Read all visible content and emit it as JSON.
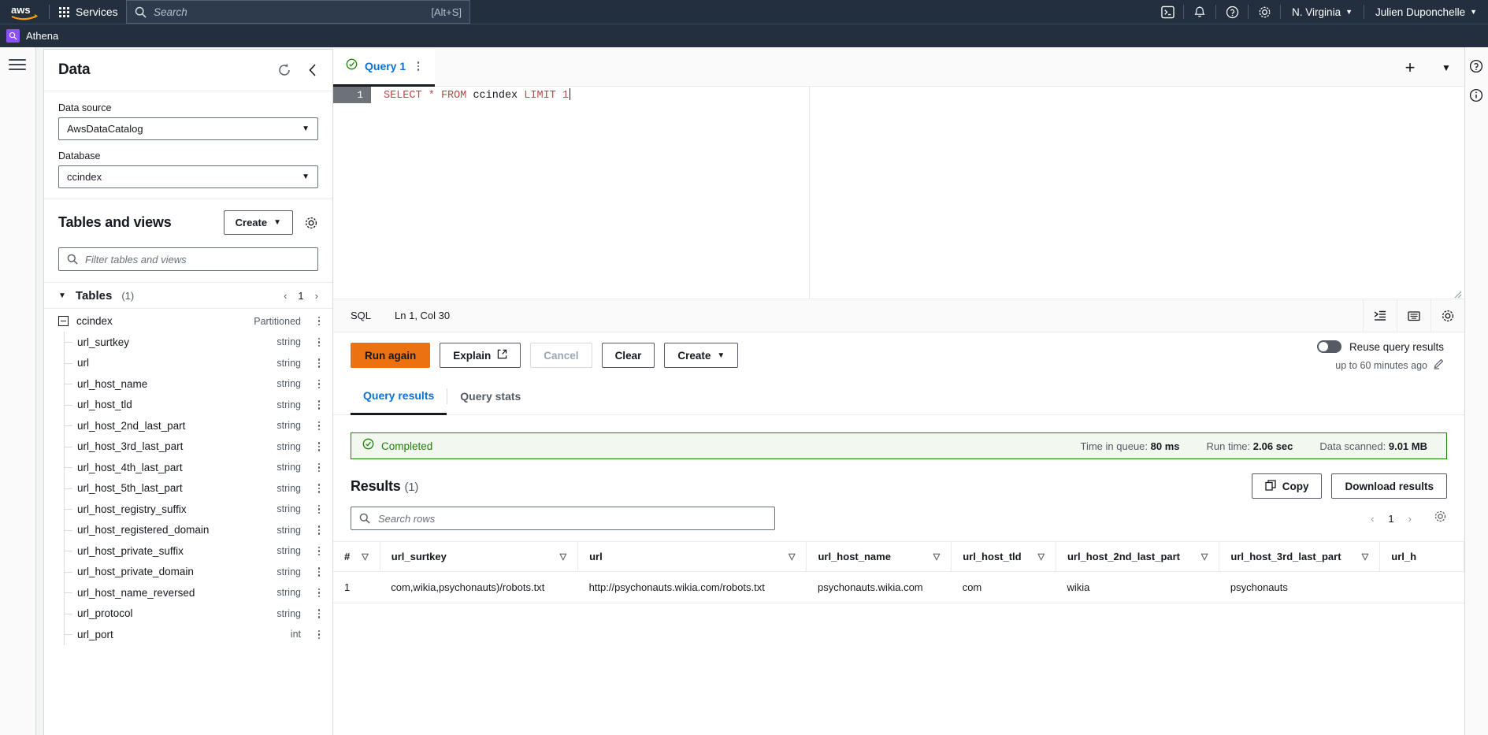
{
  "topnav": {
    "logo_alt": "aws",
    "services_label": "Services",
    "search_placeholder": "Search",
    "search_shortcut": "[Alt+S]",
    "region_label": "N. Virginia",
    "account_label": "Julien Duponchelle",
    "icons": [
      "cloudshell-icon",
      "notifications-bell-icon",
      "help-question-icon",
      "settings-gear-icon"
    ]
  },
  "servicebar": {
    "service_name": "Athena"
  },
  "data_panel": {
    "title": "Data",
    "refresh_icon": "refresh-icon",
    "collapse_icon": "chevron-left-icon",
    "data_source_label": "Data source",
    "data_source_value": "AwsDataCatalog",
    "database_label": "Database",
    "database_value": "ccindex",
    "tables_views_title": "Tables and views",
    "create_label": "Create",
    "settings_icon": "gear-icon",
    "filter_placeholder": "Filter tables and views",
    "tables_header": "Tables",
    "tables_count": "(1)",
    "page_number": "1",
    "table_name": "ccindex",
    "table_meta": "Partitioned",
    "columns": [
      {
        "name": "url_surtkey",
        "type": "string"
      },
      {
        "name": "url",
        "type": "string"
      },
      {
        "name": "url_host_name",
        "type": "string"
      },
      {
        "name": "url_host_tld",
        "type": "string"
      },
      {
        "name": "url_host_2nd_last_part",
        "type": "string"
      },
      {
        "name": "url_host_3rd_last_part",
        "type": "string"
      },
      {
        "name": "url_host_4th_last_part",
        "type": "string"
      },
      {
        "name": "url_host_5th_last_part",
        "type": "string"
      },
      {
        "name": "url_host_registry_suffix",
        "type": "string"
      },
      {
        "name": "url_host_registered_domain",
        "type": "string"
      },
      {
        "name": "url_host_private_suffix",
        "type": "string"
      },
      {
        "name": "url_host_private_domain",
        "type": "string"
      },
      {
        "name": "url_host_name_reversed",
        "type": "string"
      },
      {
        "name": "url_protocol",
        "type": "string"
      },
      {
        "name": "url_port",
        "type": "int"
      }
    ]
  },
  "editor": {
    "tab_label": "Query 1",
    "tab_status_icon": "check-circle-icon",
    "tab_menu_icon": "kebab-menu-icon",
    "add_tab_icon": "plus-icon",
    "tab_dropdown_icon": "chevron-down-icon",
    "line_number": "1",
    "sql_keyword_1": "SELECT",
    "sql_star": "*",
    "sql_keyword_2": "FROM",
    "sql_table": "ccindex",
    "sql_keyword_3": "LIMIT",
    "sql_number": "1",
    "sql_full": "SELECT * FROM ccindex LIMIT 1",
    "status_language": "SQL",
    "status_position": "Ln 1, Col 30",
    "format_icon": "format-indent-icon",
    "shortcuts_icon": "keyboard-icon",
    "editor_settings_icon": "gear-icon"
  },
  "actions": {
    "run_again": "Run again",
    "explain": "Explain",
    "explain_icon": "external-link-icon",
    "cancel": "Cancel",
    "clear": "Clear",
    "create": "Create",
    "reuse_label": "Reuse query results",
    "reuse_sub": "up to 60 minutes ago",
    "reuse_edit_icon": "pencil-icon"
  },
  "results": {
    "tabs": [
      {
        "label": "Query results",
        "active": true
      },
      {
        "label": "Query stats",
        "active": false
      }
    ],
    "status": "Completed",
    "status_icon": "check-circle-icon",
    "stats": [
      {
        "key": "Time in queue:",
        "value": "80 ms"
      },
      {
        "key": "Run time:",
        "value": "2.06 sec"
      },
      {
        "key": "Data scanned:",
        "value": "9.01 MB"
      }
    ],
    "title": "Results",
    "count": "(1)",
    "copy_label": "Copy",
    "copy_icon": "copy-icon",
    "download_label": "Download results",
    "search_placeholder": "Search rows",
    "page_number": "1",
    "prev_icon": "chevron-left-icon",
    "next_icon": "chevron-right-icon",
    "preferences_icon": "gear-icon",
    "columns": [
      "#",
      "url_surtkey",
      "url",
      "url_host_name",
      "url_host_tld",
      "url_host_2nd_last_part",
      "url_host_3rd_last_part",
      "url_h"
    ],
    "rows": [
      {
        "num": "1",
        "url_surtkey": "com,wikia,psychonauts)/robots.txt",
        "url": "http://psychonauts.wikia.com/robots.txt",
        "url_host_name": "psychonauts.wikia.com",
        "url_host_tld": "com",
        "url_host_2nd_last_part": "wikia",
        "url_host_3rd_last_part": "psychonauts",
        "url_h": ""
      }
    ]
  },
  "colors": {
    "nav_bg": "#232f3e",
    "accent_orange": "#ec7211",
    "link_blue": "#0972d3",
    "success_green": "#1d8102",
    "athena_purple": "#8c4fff"
  }
}
